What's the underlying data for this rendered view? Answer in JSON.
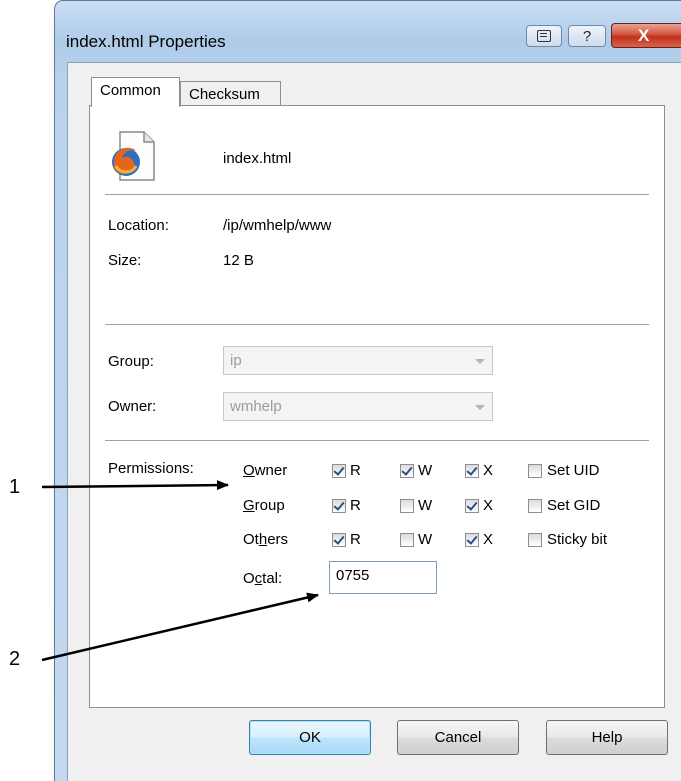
{
  "window": {
    "title": "index.html Properties",
    "close_glyph": "X",
    "help_glyph": "?"
  },
  "tabs": [
    {
      "label": "Common",
      "active": true
    },
    {
      "label": "Checksum",
      "active": false
    }
  ],
  "file": {
    "name": "index.html",
    "icon": "firefox-html-file-icon"
  },
  "info": {
    "location_label": "Location:",
    "location_value": "/ip/wmhelp/www",
    "size_label": "Size:",
    "size_value": "12 B"
  },
  "ownership": {
    "group_label": "Group:",
    "group_value": "ip",
    "owner_label": "Owner:",
    "owner_value": "wmhelp"
  },
  "permissions": {
    "label": "Permissions:",
    "columns": [
      "R",
      "W",
      "X"
    ],
    "rows": [
      {
        "label_pre": "",
        "label_u": "O",
        "label_post": "wner",
        "r": true,
        "w": true,
        "x": true,
        "special": "Set UID",
        "special_checked": false
      },
      {
        "label_pre": "",
        "label_u": "G",
        "label_post": "roup",
        "r": true,
        "w": false,
        "x": true,
        "special": "Set GID",
        "special_checked": false
      },
      {
        "label_pre": "Ot",
        "label_u": "h",
        "label_post": "ers",
        "r": true,
        "w": false,
        "x": true,
        "special": "Sticky bit",
        "special_checked": false
      }
    ],
    "octal_label_pre": "O",
    "octal_label_u": "c",
    "octal_label_post": "tal:",
    "octal_value": "0755"
  },
  "buttons": {
    "ok": "OK",
    "cancel": "Cancel",
    "help": "Help"
  },
  "callouts": [
    "1",
    "2"
  ],
  "colors": {
    "close_button": "#c0301b",
    "window_frame": "#aecbe8"
  }
}
